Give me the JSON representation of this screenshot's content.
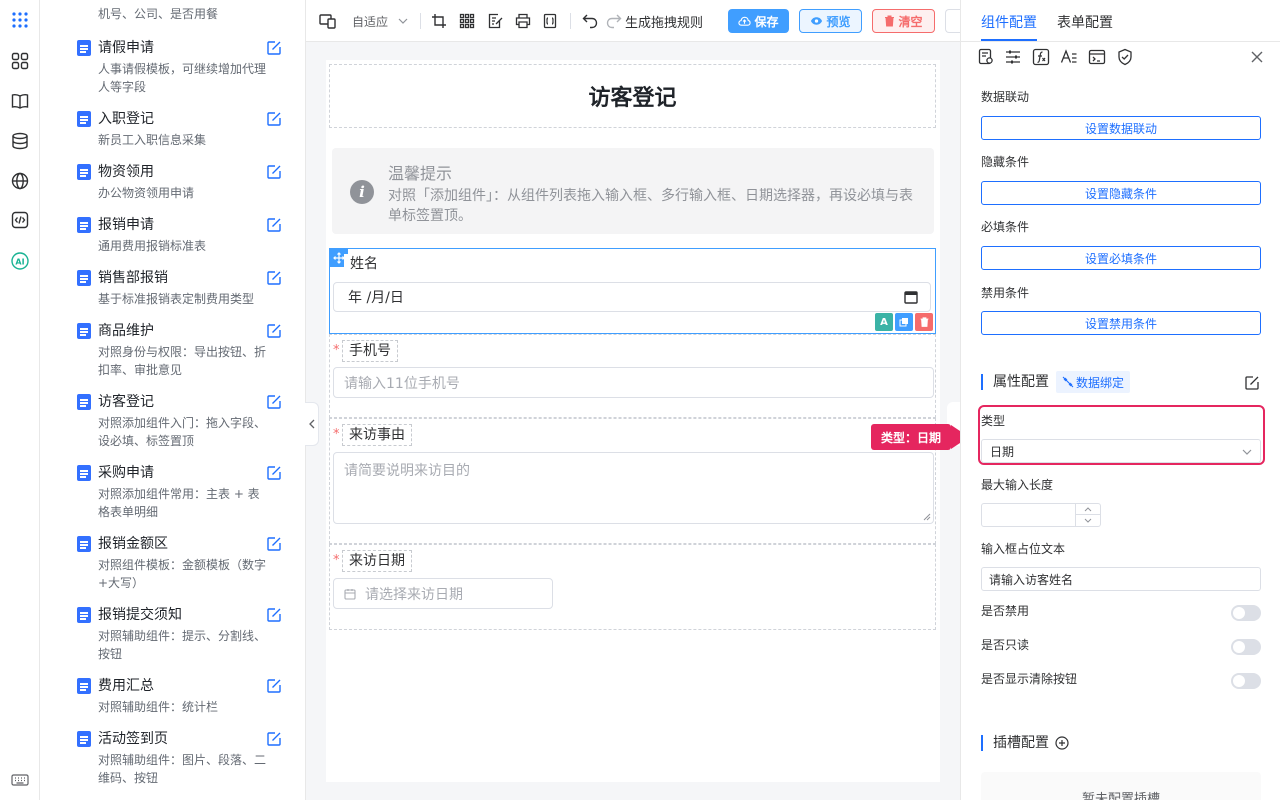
{
  "sidebar": {
    "top_desc": "机号、公司、是否用餐",
    "items": [
      {
        "name": "请假申请",
        "desc": "人事请假模板，可继续增加代理人等字段"
      },
      {
        "name": "入职登记",
        "desc": "新员工入职信息采集"
      },
      {
        "name": "物资领用",
        "desc": "办公物资领用申请"
      },
      {
        "name": "报销申请",
        "desc": "通用费用报销标准表"
      },
      {
        "name": "销售部报销",
        "desc": "基于标准报销表定制费用类型"
      },
      {
        "name": "商品维护",
        "desc": "对照身份与权限：导出按钮、折扣率、审批意见"
      },
      {
        "name": "访客登记",
        "desc": "对照添加组件入门：拖入字段、设必填、标签置顶"
      },
      {
        "name": "采购申请",
        "desc": "对照添加组件常用：主表 + 表格表单明细"
      },
      {
        "name": "报销金额区",
        "desc": "对照组件模板：金额模板（数字+大写）"
      },
      {
        "name": "报销提交须知",
        "desc": "对照辅助组件：提示、分割线、按钮"
      },
      {
        "name": "费用汇总",
        "desc": "对照辅助组件：统计栏"
      },
      {
        "name": "活动签到页",
        "desc": "对照辅助组件：图片、段落、二维码、按钮"
      }
    ]
  },
  "toolbar": {
    "layout_mode": "自适应",
    "rule_label": "生成拖拽规则",
    "save_label": "保存",
    "preview_label": "预览",
    "clear_label": "清空"
  },
  "form": {
    "title": "访客登记",
    "tip_title": "温馨提示",
    "tip_text": "对照「添加组件」：从组件列表拖入输入框、多行输入框、日期选择器，再设必填与表单标签置顶。",
    "fields": [
      {
        "label": "姓名",
        "value": "年 /月/日"
      },
      {
        "label": "手机号",
        "placeholder": "请输入11位手机号"
      },
      {
        "label": "来访事由",
        "placeholder": "请简要说明来访目的"
      },
      {
        "label": "来访日期",
        "placeholder": "请选择来访日期"
      }
    ]
  },
  "panel": {
    "tabs": [
      "组件配置",
      "表单配置"
    ],
    "data_link": {
      "label": "数据联动",
      "button": "设置数据联动"
    },
    "hide_cond": {
      "label": "隐藏条件",
      "button": "设置隐藏条件"
    },
    "required_cond": {
      "label": "必填条件",
      "button": "设置必填条件"
    },
    "disable_cond": {
      "label": "禁用条件",
      "button": "设置禁用条件"
    },
    "attr_title": "属性配置",
    "data_binding": "数据绑定",
    "type_label": "类型",
    "type_value": "日期",
    "max_len_label": "最大输入长度",
    "placeholder_label": "输入框占位文本",
    "placeholder_value": "请输入访客姓名",
    "disabled_label": "是否禁用",
    "readonly_label": "是否只读",
    "clear_btn_label": "是否显示清除按钮",
    "slot_title": "插槽配置",
    "slot_empty": "暂未配置插槽"
  },
  "callout": "类型：日期",
  "colors": {
    "accent": "#1e6fff",
    "highlight": "#e5265f",
    "danger": "#f56c6c"
  }
}
